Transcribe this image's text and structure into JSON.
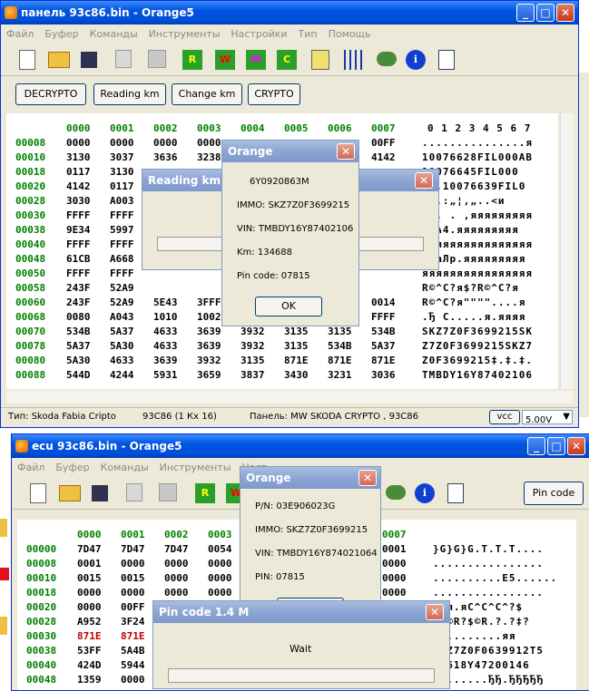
{
  "win1": {
    "title": "панель 93c86.bin - Orange5",
    "menu": [
      "Файл",
      "Буфер",
      "Команды",
      "Инструменты",
      "Настройки",
      "Тип",
      "Помощь"
    ],
    "toolbar_letters": [
      "R",
      "W",
      "M",
      "C"
    ],
    "buttons": [
      "DECRYPTO",
      "Reading km",
      "Change km",
      "CRYPTO"
    ],
    "hex_header": [
      "0000",
      "0001",
      "0002",
      "0003",
      "0004",
      "0005",
      "0006",
      "0007"
    ],
    "ascii_header": "0 1 2 3 4 5 6 7",
    "rows": [
      {
        "addr": "00008",
        "cells": [
          "0000",
          "0000",
          "0000",
          "0000",
          "",
          "",
          "",
          "00FF"
        ],
        "ascii": "...............я"
      },
      {
        "addr": "00010",
        "cells": [
          "3130",
          "3037",
          "3636",
          "3238",
          "",
          "",
          "",
          "4142"
        ],
        "ascii": "10076628FIL000AB"
      },
      {
        "addr": "00018",
        "cells": [
          "0117",
          "3130",
          "",
          "",
          "",
          "",
          "",
          ""
        ],
        "ascii": "10076645FIL000"
      },
      {
        "addr": "00020",
        "cells": [
          "4142",
          "0117",
          "",
          "",
          "",
          "",
          "",
          ""
        ],
        "ascii": "...10076639FIL0"
      },
      {
        "addr": "00028",
        "cells": [
          "3030",
          "A003",
          "",
          "",
          "",
          "",
          "",
          ""
        ],
        "ascii": "...:„¦,„..<и"
      },
      {
        "addr": "00030",
        "cells": [
          "FFFF",
          "FFFF",
          "",
          "",
          "",
          "",
          "",
          ""
        ],
        "ascii": "я . . ,яяяяяяяяя"
      },
      {
        "addr": "00038",
        "cells": [
          "9E34",
          "5997",
          "",
          "",
          "",
          "",
          "",
          ""
        ],
        "ascii": "Y-ћ4.яяяяяяяяя"
      },
      {
        "addr": "00040",
        "cells": [
          "FFFF",
          "FFFF",
          "",
          "",
          "",
          "",
          "",
          ""
        ],
        "ascii": "яяяяяяяяяяяяяяяя"
      },
      {
        "addr": "00048",
        "cells": [
          "61CB",
          "A668",
          "",
          "",
          "",
          "",
          "",
          ""
        ],
        "ascii": "¦haЛр.яяяяяяяяя"
      },
      {
        "addr": "00050",
        "cells": [
          "FFFF",
          "FFFF",
          "",
          "",
          "",
          "",
          "",
          ""
        ],
        "ascii": "яяяяяяяяяяяяяяяя"
      },
      {
        "addr": "00058",
        "cells": [
          "243F",
          "52A9",
          "",
          "",
          "",
          "",
          "",
          ""
        ],
        "ascii": "R©^C?я$?R©^C?я"
      },
      {
        "addr": "00060",
        "cells": [
          "243F",
          "52A9",
          "5E43",
          "3FFF",
          "",
          "",
          "",
          "0014"
        ],
        "ascii": "R©^C?я\"\"\"\"....я"
      },
      {
        "addr": "00068",
        "cells": [
          "0080",
          "A043",
          "1010",
          "1002",
          "",
          "",
          "",
          "FFFF"
        ],
        "ascii": ".Ђ C.....я.яяяя"
      },
      {
        "addr": "00070",
        "cells": [
          "534B",
          "5A37",
          "4633",
          "3639",
          "3932",
          "3135",
          "3135",
          "534B"
        ],
        "ascii": "SKZ7Z0F3699215SK"
      },
      {
        "addr": "00078",
        "cells": [
          "5A37",
          "5A30",
          "4633",
          "3639",
          "3932",
          "3135",
          "534B",
          "5A37"
        ],
        "ascii": "Z7Z0F3699215SKZ7"
      },
      {
        "addr": "00080",
        "cells": [
          "5A30",
          "4633",
          "3639",
          "3932",
          "3135",
          "871E",
          "871E",
          "871E"
        ],
        "ascii": "Z0F3699215‡.‡.‡."
      },
      {
        "addr": "00088",
        "cells": [
          "544D",
          "4244",
          "5931",
          "3659",
          "3837",
          "3430",
          "3231",
          "3036"
        ],
        "ascii": "TMBDY16Y87402106"
      }
    ],
    "status": {
      "type": "Тип: Skoda Fabia  Cripto",
      "chip": "93C86 (1 Кх 16)",
      "panel": "Панель: MW   SKODA CRYPTO , 93C86",
      "vcc": "vcc",
      "voltage": "5.00V"
    }
  },
  "dlg_reading": {
    "title": "Reading km F"
  },
  "dlg_orange1": {
    "title": "Orange",
    "lines": [
      "6Y0920863M",
      "IMMO: SKZ7Z0F3699215",
      "VIN: TMBDY16Y87402106",
      "Km:    134688",
      "Pin code: 07815"
    ],
    "ok": "OK"
  },
  "win2": {
    "title": "ecu 93c86.bin - Orange5",
    "menu": [
      "Файл",
      "Буфер",
      "Команды",
      "Инструменты",
      "Наст"
    ],
    "pin_button": "Pin code",
    "hex_header": [
      "0000",
      "0001",
      "0002",
      "0003",
      "",
      "",
      "",
      "0007"
    ],
    "rows": [
      {
        "addr": "00000",
        "cells": [
          "7D47",
          "7D47",
          "7D47",
          "0054",
          "",
          "",
          "",
          "0001"
        ],
        "ascii": "}G}G}G.T.T.T...."
      },
      {
        "addr": "00008",
        "cells": [
          "0001",
          "0000",
          "0000",
          "0000",
          "",
          "",
          "",
          "0000"
        ],
        "ascii": "................"
      },
      {
        "addr": "00010",
        "cells": [
          "0015",
          "0015",
          "0000",
          "0000",
          "",
          "",
          "",
          "0000"
        ],
        "ascii": "..........E5......"
      },
      {
        "addr": "00018",
        "cells": [
          "0000",
          "0000",
          "0000",
          "0000",
          "",
          "",
          "",
          "0000"
        ],
        "ascii": "................"
      },
      {
        "addr": "00020",
        "cells": [
          "0000",
          "00FF",
          "",
          "",
          "",
          "",
          "",
          ""
        ],
        "ascii": "я.я.яС^С^С^?$"
      },
      {
        "addr": "00028",
        "cells": [
          "A952",
          "3F24",
          "",
          "",
          "",
          "",
          "",
          ""
        ],
        "ascii": "?$©R?$©R.?.?‡?"
      },
      {
        "addr": "00030",
        "cells": [
          "871E",
          "871E",
          "",
          "",
          "",
          "",
          "",
          ""
        ],
        "ascii": "..........яя"
      },
      {
        "addr": "00038",
        "cells": [
          "53FF",
          "5A4B",
          "",
          "",
          "",
          "",
          "",
          ""
        ],
        "ascii": "ZKZ7Z0F0639912T5"
      },
      {
        "addr": "00040",
        "cells": [
          "424D",
          "5944",
          "",
          "",
          "",
          "",
          "",
          ""
        ],
        "ascii": "YD618Y47200146"
      },
      {
        "addr": "00048",
        "cells": [
          "1359",
          "0000",
          "",
          "",
          "",
          "",
          "",
          ""
        ],
        "ascii": "........ЂЂ.ЂЂЂЂЂ"
      }
    ]
  },
  "dlg_orange2": {
    "title": "Orange",
    "lines": [
      "P/N: 03E906023G",
      "IMMO: SKZ7Z0F3699215",
      "VIN: TMBDY16Y874021064",
      "PIN: 07815"
    ],
    "ok": "OK"
  },
  "dlg_pin": {
    "title": "Pin code 1.4 M",
    "wait": "Wait"
  },
  "colors": {
    "xp_blue": "#0054e3",
    "hex_green": "#008000",
    "red_bytes": "#c00000"
  }
}
